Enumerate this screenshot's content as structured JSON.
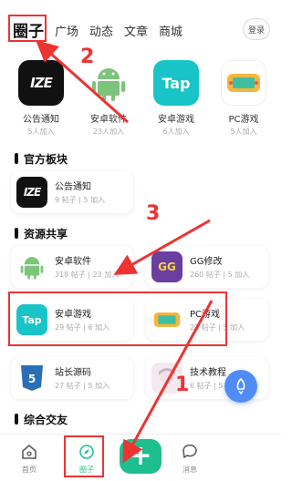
{
  "topnav": {
    "tabs": [
      "圈子",
      "广场",
      "动态",
      "文章",
      "商城"
    ],
    "login": "登录"
  },
  "featured": [
    {
      "name": "公告通知",
      "count": "5人加入",
      "icon": "ize-logo"
    },
    {
      "name": "安卓软件",
      "count": "23人加入",
      "icon": "android-icon"
    },
    {
      "name": "安卓游戏",
      "count": "6人加入",
      "icon": "taptap-icon"
    },
    {
      "name": "PC游戏",
      "count": "5人加入",
      "icon": "gamepad-icon"
    }
  ],
  "sections": {
    "official": "官方板块",
    "resources": "资源共享",
    "chat": "综合交友"
  },
  "official_cards": [
    {
      "name": "公告通知",
      "stats": "9 帖子 | 5 加入"
    }
  ],
  "resource_cards": [
    {
      "name": "安卓软件",
      "stats": "318 帖子 | 23 加入"
    },
    {
      "name": "GG修改",
      "stats": "260 帖子 | 5 加入"
    },
    {
      "name": "安卓游戏",
      "stats": "29 帖子 | 6 加入"
    },
    {
      "name": "PC游戏",
      "stats": "23 帖子 | 5 加入"
    },
    {
      "name": "站长源码",
      "stats": "27 帖子 | 5 加入"
    },
    {
      "name": "技术教程",
      "stats": "6 帖子 | 5 加入"
    }
  ],
  "bottombar": {
    "home": "首页",
    "circle": "圈子",
    "message": "消息"
  },
  "annotations": [
    "1",
    "2",
    "3"
  ],
  "colors": {
    "accent_green": "#1dbf8f",
    "annotation_red": "#e33333",
    "fab_blue": "#4f8cf6"
  }
}
